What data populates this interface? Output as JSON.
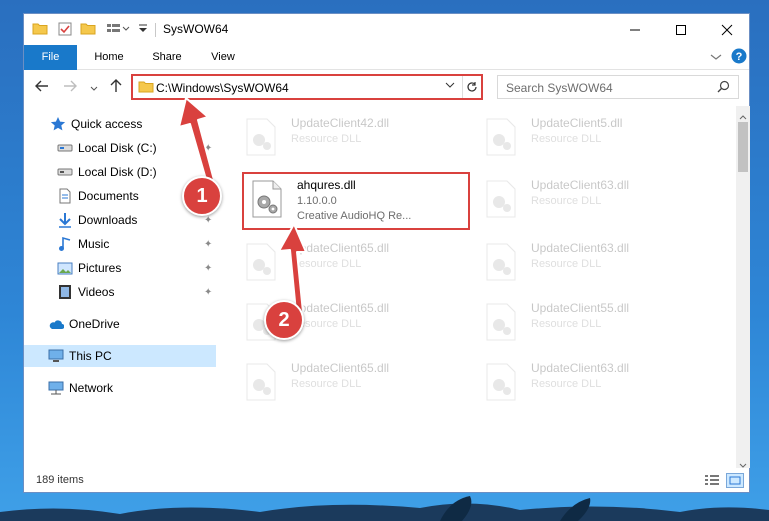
{
  "window": {
    "title": "SysWOW64"
  },
  "ribbon": {
    "tabs": [
      "File",
      "Home",
      "Share",
      "View"
    ]
  },
  "address_bar": {
    "path": "C:\\Windows\\SysWOW64"
  },
  "search": {
    "placeholder": "Search SysWOW64"
  },
  "sidebar": {
    "items": [
      {
        "label": "Quick access",
        "icon": "star-icon"
      },
      {
        "label": "Local Disk (C:)",
        "icon": "drive-icon",
        "pinned": true
      },
      {
        "label": "Local Disk (D:)",
        "icon": "drive-icon",
        "pinned": true
      },
      {
        "label": "Documents",
        "icon": "documents-icon",
        "pinned": true
      },
      {
        "label": "Downloads",
        "icon": "downloads-icon",
        "pinned": true
      },
      {
        "label": "Music",
        "icon": "music-icon",
        "pinned": true
      },
      {
        "label": "Pictures",
        "icon": "pictures-icon",
        "pinned": true
      },
      {
        "label": "Videos",
        "icon": "videos-icon",
        "pinned": true
      },
      {
        "label": "OneDrive",
        "icon": "onedrive-icon"
      },
      {
        "label": "This PC",
        "icon": "pc-icon",
        "selected": true
      },
      {
        "label": "Network",
        "icon": "network-icon"
      }
    ]
  },
  "files": {
    "highlighted": {
      "name": "ahqures.dll",
      "version": "1.10.0.0",
      "description": "Creative AudioHQ Re..."
    },
    "background": [
      {
        "name": "UpdateClient42.dll",
        "description": "Resource DLL"
      },
      {
        "name": "UpdateClient5.dll",
        "description": "Resource DLL"
      },
      {
        "name": "UpdateClient63.dll",
        "description": "Resource DLL"
      },
      {
        "name": "UpdateClient65.dll",
        "description": "Resource DLL"
      },
      {
        "name": "UpdateClient63.dll",
        "description": "Resource DLL"
      },
      {
        "name": "UpdateClient65.dll",
        "description": "Resource DLL"
      },
      {
        "name": "UpdateClient55.dll",
        "description": "Resource DLL"
      },
      {
        "name": "UpdateClient65.dll",
        "description": "Resource DLL"
      },
      {
        "name": "UpdateClient63.dll",
        "description": "Resource DLL"
      }
    ]
  },
  "status": {
    "items_count": "189 items"
  },
  "annotations": {
    "marker1": "1",
    "marker2": "2",
    "color": "#d9413e"
  }
}
